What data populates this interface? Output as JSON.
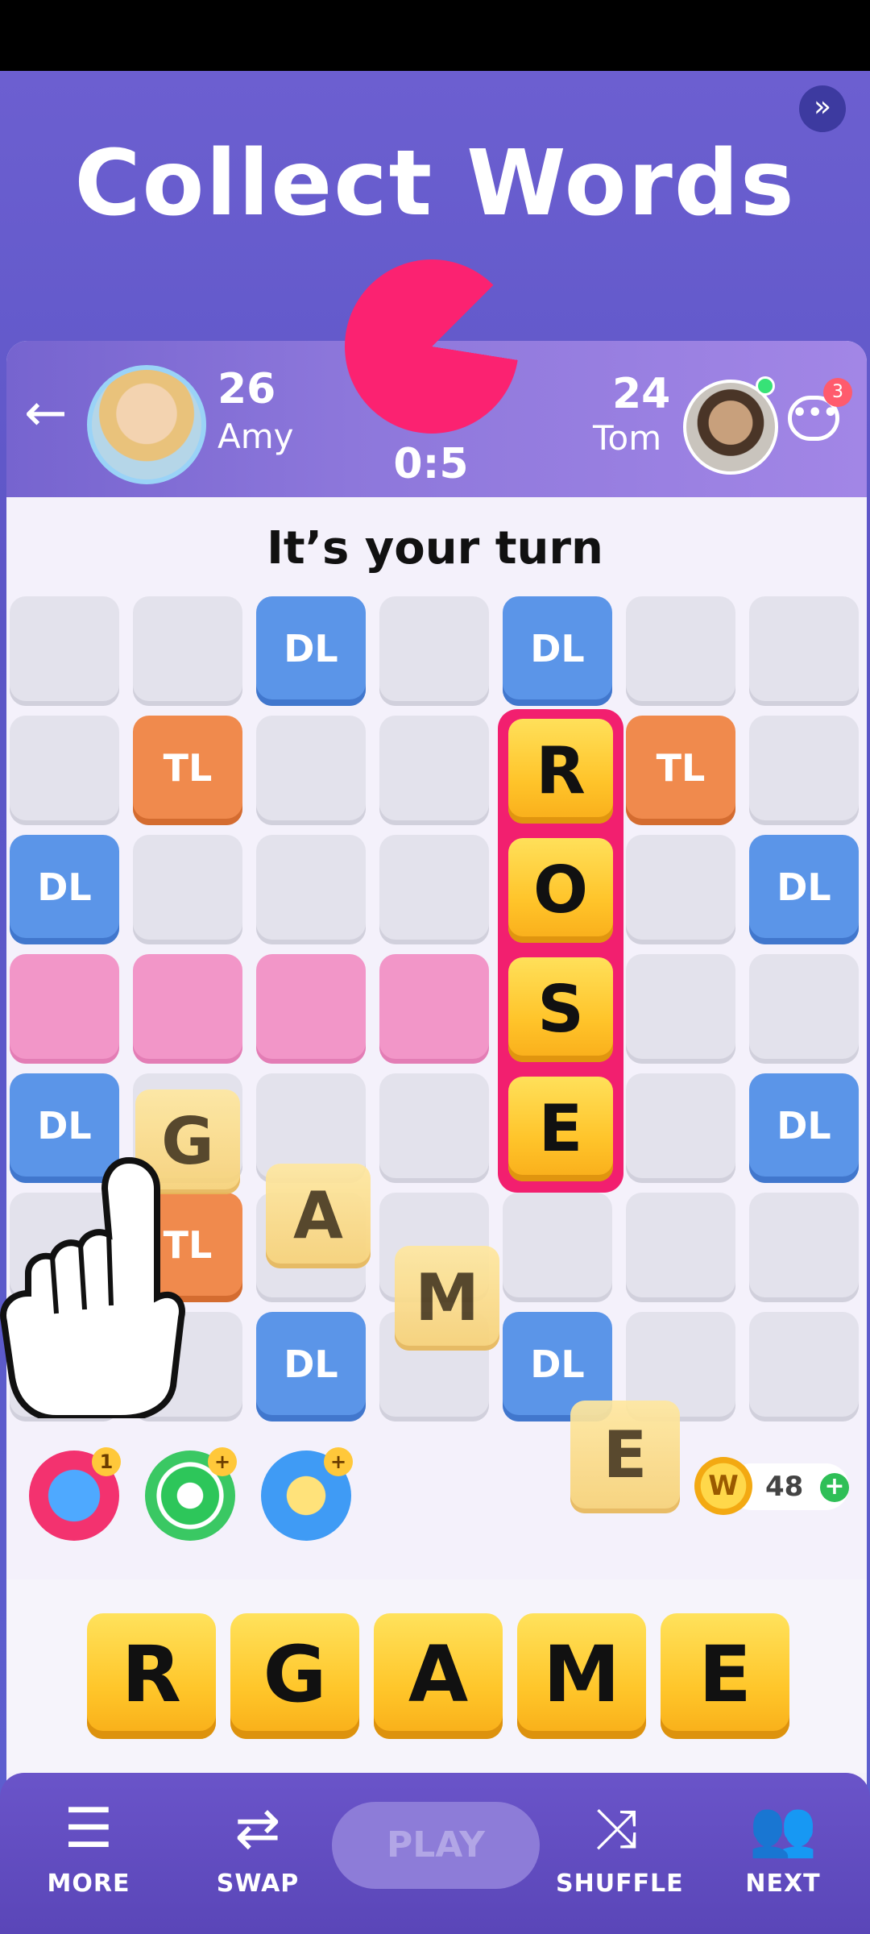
{
  "headline": "Collect Words",
  "skip_icon": "double-chevron-right",
  "player_left": {
    "score": "26",
    "name": "Amy"
  },
  "player_right": {
    "score": "24",
    "name": "Tom"
  },
  "timer": "0:5",
  "chat_badge": "3",
  "turn_message": "It’s your turn",
  "board_labels": {
    "dl": "DL",
    "tl": "TL"
  },
  "placed_word": [
    "R",
    "O",
    "S",
    "E"
  ],
  "dragging_letters": [
    "G",
    "A",
    "M",
    "E"
  ],
  "powerups": {
    "swap_badge": "1",
    "target_badge": "+",
    "hint_badge": "+"
  },
  "coins": {
    "symbol": "W",
    "count": "48",
    "plus": "+"
  },
  "rack": [
    "R",
    "G",
    "A",
    "M",
    "E"
  ],
  "nav": {
    "more": "MORE",
    "swap": "SWAP",
    "play": "PLAY",
    "shuffle": "SHUFFLE",
    "next": "NEXT"
  },
  "colors": {
    "accent_pink": "#fb2271",
    "dl_blue": "#5b95e8",
    "tl_orange": "#f08a4d",
    "tile_yellow": "#ffc42a",
    "nav_purple": "#6a54c9"
  }
}
